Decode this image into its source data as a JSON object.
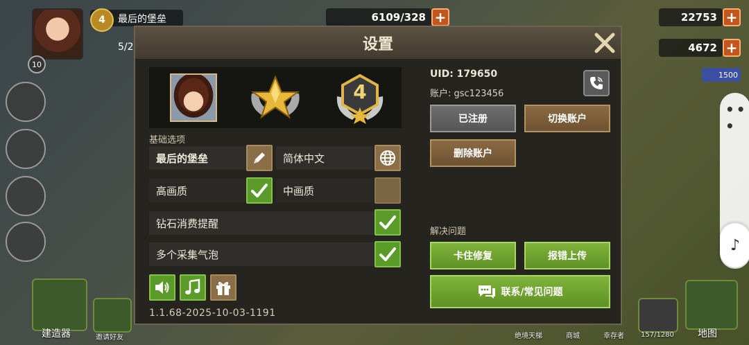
{
  "hud": {
    "player_level": "10",
    "alliance_level": "4",
    "player_name": "最后的堡垒",
    "squad_count": "5/2",
    "resource_main": "6109/328",
    "coins": "22753",
    "gems": "4672",
    "reward_badge": "1500",
    "bottom": {
      "builder": "建造器",
      "invite": "邀请好友",
      "tower": "绝境天梯",
      "shop": "商城",
      "survivors": "幸存者",
      "storage": "157/1280",
      "map": "地图"
    }
  },
  "dialog": {
    "title": "设置",
    "close_label": "X",
    "profile": {
      "rank_number": "4"
    },
    "basic_options_label": "基础选项",
    "options": [
      {
        "label": "最后的堡垒",
        "icon": "pencil-icon"
      },
      {
        "label": "简体中文",
        "icon": "globe-icon"
      },
      {
        "label": "高画质",
        "checked": true
      },
      {
        "label": "中画质",
        "checked": false
      },
      {
        "label": "钻石消费提醒",
        "checked": true
      },
      {
        "label": "多个采集气泡",
        "checked": true
      }
    ],
    "audio_buttons": [
      "sound-icon",
      "music-icon",
      "gift-icon"
    ],
    "version": "1.1.68-2025-10-03-1191",
    "uid": "UID: 179650",
    "account": "账户: gsc123456",
    "registered_label": "已注册",
    "switch_account_label": "切换账户",
    "delete_account_label": "删除账户",
    "problems_label": "解决问题",
    "stuck_fix_label": "卡住修复",
    "report_bug_label": "报错上传",
    "contact_label": "联系/常见问题"
  },
  "colors": {
    "accent_green": "#5a9b2a",
    "accent_brown": "#8a6e47",
    "dialog_bg": "#26241f",
    "title_text": "#f0e6cf"
  }
}
